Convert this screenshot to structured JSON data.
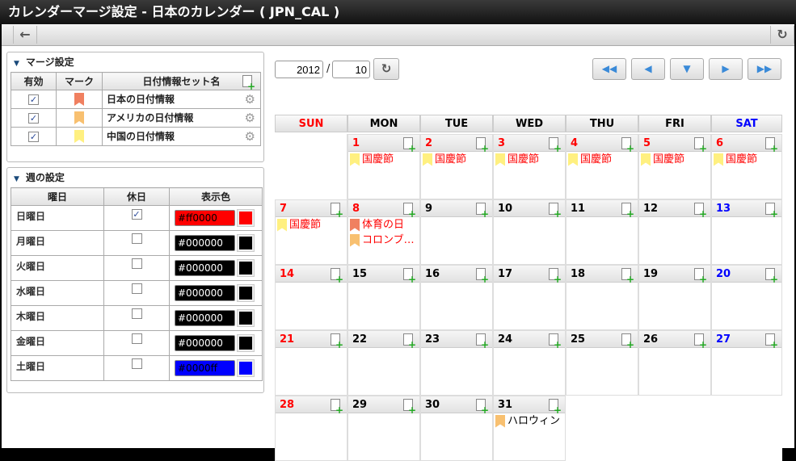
{
  "title": "カレンダーマージ設定 - 日本のカレンダー ( JPN_CAL )",
  "toolbar": {
    "back_icon": "arrow-left-icon",
    "reload_icon": "reload-icon"
  },
  "merge": {
    "title": "マージ設定",
    "headers": [
      "有効",
      "マーク",
      "日付情報セット名"
    ],
    "rows": [
      {
        "enabled": true,
        "mark_color": "#f08060",
        "name": "日本の日付情報"
      },
      {
        "enabled": true,
        "mark_color": "#f8c070",
        "name": "アメリカの日付情報"
      },
      {
        "enabled": true,
        "mark_color": "#fff080",
        "name": "中国の日付情報"
      }
    ]
  },
  "week": {
    "title": "週の設定",
    "headers": [
      "曜日",
      "休日",
      "表示色"
    ],
    "rows": [
      {
        "day": "日曜日",
        "holiday": true,
        "color": "#ff0000"
      },
      {
        "day": "月曜日",
        "holiday": false,
        "color": "#000000"
      },
      {
        "day": "火曜日",
        "holiday": false,
        "color": "#000000"
      },
      {
        "day": "水曜日",
        "holiday": false,
        "color": "#000000"
      },
      {
        "day": "木曜日",
        "holiday": false,
        "color": "#000000"
      },
      {
        "day": "金曜日",
        "holiday": false,
        "color": "#000000"
      },
      {
        "day": "土曜日",
        "holiday": false,
        "color": "#0000ff"
      }
    ]
  },
  "calendar": {
    "year": "2012",
    "sep": "/",
    "month": "10",
    "weekdays": [
      {
        "label": "SUN",
        "color": "#ff0000"
      },
      {
        "label": "MON",
        "color": "#000000"
      },
      {
        "label": "TUE",
        "color": "#000000"
      },
      {
        "label": "WED",
        "color": "#000000"
      },
      {
        "label": "THU",
        "color": "#000000"
      },
      {
        "label": "FRI",
        "color": "#000000"
      },
      {
        "label": "SAT",
        "color": "#0000ff"
      }
    ],
    "weeks": [
      [
        null,
        {
          "d": "1",
          "c": "#ff0000",
          "ev": [
            {
              "t": "国慶節",
              "m": "#fff080",
              "c": "#ff0000"
            }
          ]
        },
        {
          "d": "2",
          "c": "#ff0000",
          "ev": [
            {
              "t": "国慶節",
              "m": "#fff080",
              "c": "#ff0000"
            }
          ]
        },
        {
          "d": "3",
          "c": "#ff0000",
          "ev": [
            {
              "t": "国慶節",
              "m": "#fff080",
              "c": "#ff0000"
            }
          ]
        },
        {
          "d": "4",
          "c": "#ff0000",
          "ev": [
            {
              "t": "国慶節",
              "m": "#fff080",
              "c": "#ff0000"
            }
          ]
        },
        {
          "d": "5",
          "c": "#ff0000",
          "ev": [
            {
              "t": "国慶節",
              "m": "#fff080",
              "c": "#ff0000"
            }
          ]
        },
        {
          "d": "6",
          "c": "#ff0000",
          "ev": [
            {
              "t": "国慶節",
              "m": "#fff080",
              "c": "#ff0000"
            }
          ]
        }
      ],
      [
        {
          "d": "7",
          "c": "#ff0000",
          "ev": [
            {
              "t": "国慶節",
              "m": "#fff080",
              "c": "#ff0000"
            }
          ]
        },
        {
          "d": "8",
          "c": "#ff0000",
          "ev": [
            {
              "t": "体育の日",
              "m": "#f08060",
              "c": "#ff0000"
            },
            {
              "t": "コロンブ…",
              "m": "#f8c070",
              "c": "#ff0000"
            }
          ]
        },
        {
          "d": "9",
          "c": "#000000",
          "ev": []
        },
        {
          "d": "10",
          "c": "#000000",
          "ev": []
        },
        {
          "d": "11",
          "c": "#000000",
          "ev": []
        },
        {
          "d": "12",
          "c": "#000000",
          "ev": []
        },
        {
          "d": "13",
          "c": "#0000ff",
          "ev": []
        }
      ],
      [
        {
          "d": "14",
          "c": "#ff0000",
          "ev": []
        },
        {
          "d": "15",
          "c": "#000000",
          "ev": []
        },
        {
          "d": "16",
          "c": "#000000",
          "ev": []
        },
        {
          "d": "17",
          "c": "#000000",
          "ev": []
        },
        {
          "d": "18",
          "c": "#000000",
          "ev": []
        },
        {
          "d": "19",
          "c": "#000000",
          "ev": []
        },
        {
          "d": "20",
          "c": "#0000ff",
          "ev": []
        }
      ],
      [
        {
          "d": "21",
          "c": "#ff0000",
          "ev": []
        },
        {
          "d": "22",
          "c": "#000000",
          "ev": []
        },
        {
          "d": "23",
          "c": "#000000",
          "ev": []
        },
        {
          "d": "24",
          "c": "#000000",
          "ev": []
        },
        {
          "d": "25",
          "c": "#000000",
          "ev": []
        },
        {
          "d": "26",
          "c": "#000000",
          "ev": []
        },
        {
          "d": "27",
          "c": "#0000ff",
          "ev": []
        }
      ],
      [
        {
          "d": "28",
          "c": "#ff0000",
          "ev": []
        },
        {
          "d": "29",
          "c": "#000000",
          "ev": []
        },
        {
          "d": "30",
          "c": "#000000",
          "ev": []
        },
        {
          "d": "31",
          "c": "#000000",
          "ev": [
            {
              "t": "ハロウィン",
              "m": "#f8c070",
              "c": "#000000"
            }
          ]
        },
        null,
        null,
        null
      ]
    ]
  }
}
